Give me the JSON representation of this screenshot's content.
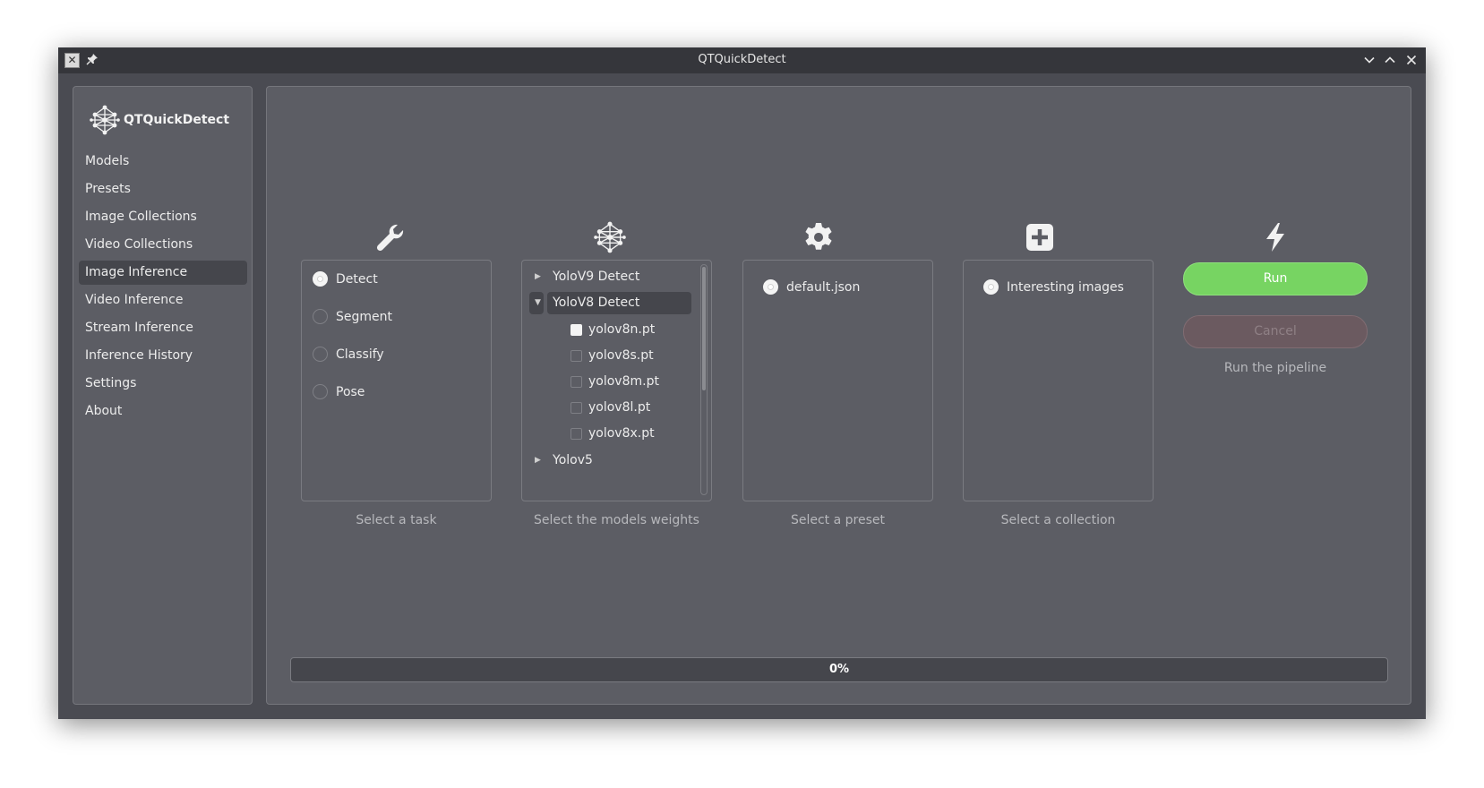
{
  "window": {
    "title": "QTQuickDetect"
  },
  "sidebar": {
    "app_name": "QTQuickDetect",
    "items": [
      {
        "label": "Models"
      },
      {
        "label": "Presets"
      },
      {
        "label": "Image Collections"
      },
      {
        "label": "Video Collections"
      },
      {
        "label": "Image Inference",
        "active": true
      },
      {
        "label": "Video Inference"
      },
      {
        "label": "Stream Inference"
      },
      {
        "label": "Inference History"
      },
      {
        "label": "Settings"
      },
      {
        "label": "About"
      }
    ]
  },
  "task": {
    "icon": "wrench-icon",
    "caption": "Select a task",
    "options": [
      {
        "label": "Detect",
        "checked": true
      },
      {
        "label": "Segment",
        "checked": false
      },
      {
        "label": "Classify",
        "checked": false
      },
      {
        "label": "Pose",
        "checked": false
      }
    ]
  },
  "models": {
    "icon": "neural-network-icon",
    "caption": "Select the models weights",
    "groups": [
      {
        "label": "YoloV9 Detect",
        "expanded": false
      },
      {
        "label": "YoloV8 Detect",
        "expanded": true,
        "selected": true,
        "weights": [
          {
            "label": "yolov8n.pt",
            "checked": true
          },
          {
            "label": "yolov8s.pt",
            "checked": false
          },
          {
            "label": "yolov8m.pt",
            "checked": false
          },
          {
            "label": "yolov8l.pt",
            "checked": false
          },
          {
            "label": "yolov8x.pt",
            "checked": false
          }
        ]
      },
      {
        "label": "Yolov5",
        "expanded": false
      }
    ]
  },
  "preset": {
    "icon": "gear-icon",
    "caption": "Select a preset",
    "options": [
      {
        "label": "default.json",
        "checked": true
      }
    ]
  },
  "collection": {
    "icon": "plus-square-icon",
    "caption": "Select a collection",
    "options": [
      {
        "label": "Interesting images",
        "checked": true
      }
    ]
  },
  "actions": {
    "icon": "lightning-icon",
    "run_label": "Run",
    "cancel_label": "Cancel",
    "caption": "Run the pipeline",
    "colors": {
      "run": "#77d462",
      "cancel": "#6b5a60"
    }
  },
  "progress": {
    "value": 0,
    "text": "0%"
  }
}
